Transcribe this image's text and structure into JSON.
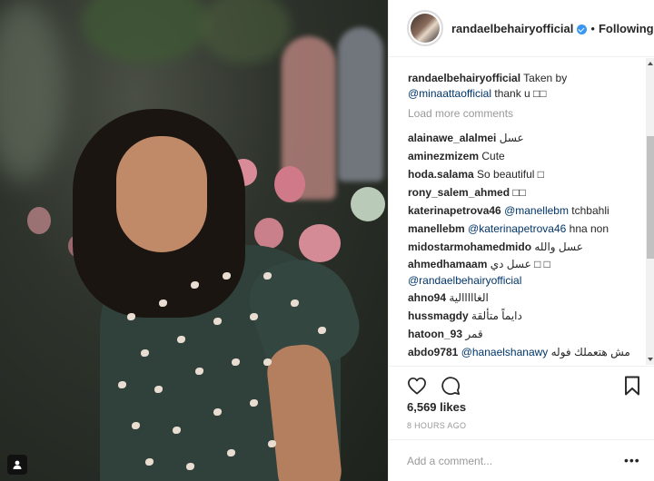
{
  "header": {
    "username": "randaelbehairyofficial",
    "separator": "•",
    "follow_status": "Following"
  },
  "comments": {
    "caption": {
      "user": "randaelbehairyofficial",
      "text": "Taken by",
      "mention": "@minaattaofficial",
      "tail": "thank u □□"
    },
    "load_more": "Load more comments",
    "items": [
      {
        "user": "alainawe_alalmei",
        "text": "عسل"
      },
      {
        "user": "aminezmizem",
        "text": "Cute"
      },
      {
        "user": "hoda.salama",
        "text": "So beautiful □"
      },
      {
        "user": "rony_salem_ahmed",
        "text": "□□"
      },
      {
        "user": "katerinapetrova46",
        "mention": "@manellebm",
        "text": "tchbahli"
      },
      {
        "user": "manellebm",
        "mention": "@katerinapetrova46",
        "text": "hna non"
      },
      {
        "user": "midostarmohamedmido",
        "text": "عسل والله"
      },
      {
        "user": "ahmedhamaam",
        "text": "عسل دي □ □",
        "mention2": "@randaelbehairyofficial"
      },
      {
        "user": "ahno94",
        "text": "الغااااالية"
      },
      {
        "user": "hussmagdy",
        "text": "دايماً متألقة"
      },
      {
        "user": "hatoon_93",
        "text": "قمر"
      },
      {
        "user": "abdo9781",
        "mention": "@hanaelshanawy",
        "text": "مش هتعملك فوله"
      }
    ]
  },
  "stats": {
    "likes": "6,569 likes",
    "time": "8 HOURS AGO"
  },
  "add_comment": {
    "placeholder": "Add a comment...",
    "more": "•••"
  },
  "icons": {
    "heart": "heart-icon",
    "comment": "comment-bubble-icon",
    "bookmark": "bookmark-icon",
    "verified": "verified-badge-icon",
    "tag": "user-tag-icon"
  },
  "colors": {
    "verified_blue": "#3897f0",
    "mention_blue": "#003569",
    "muted_gray": "#999999"
  }
}
